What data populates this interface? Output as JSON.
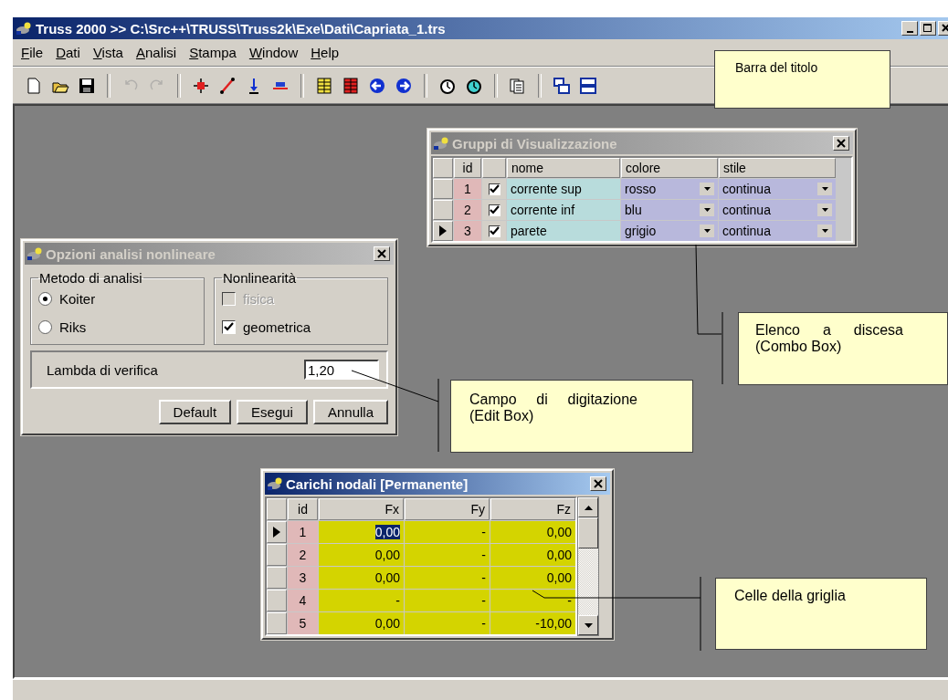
{
  "window": {
    "title": "Truss 2000 >> C:\\Src++\\TRUSS\\Truss2k\\Exe\\Dati\\Capriata_1.trs",
    "active": true
  },
  "menu": [
    {
      "label": "File"
    },
    {
      "label": "Dati"
    },
    {
      "label": "Vista"
    },
    {
      "label": "Analisi"
    },
    {
      "label": "Stampa"
    },
    {
      "label": "Window"
    },
    {
      "label": "Help"
    }
  ],
  "toolbar": [
    {
      "kind": "new",
      "disabled": false
    },
    {
      "kind": "open",
      "disabled": false
    },
    {
      "kind": "save",
      "disabled": false
    },
    {
      "kind": "sep"
    },
    {
      "kind": "undo",
      "disabled": true
    },
    {
      "kind": "redo",
      "disabled": true
    },
    {
      "kind": "sep"
    },
    {
      "kind": "node",
      "disabled": false
    },
    {
      "kind": "line",
      "disabled": false
    },
    {
      "kind": "load",
      "disabled": false
    },
    {
      "kind": "dload",
      "disabled": false
    },
    {
      "kind": "sep"
    },
    {
      "kind": "grid",
      "disabled": false
    },
    {
      "kind": "grid2",
      "disabled": false
    },
    {
      "kind": "back",
      "disabled": false
    },
    {
      "kind": "forward",
      "disabled": false
    },
    {
      "kind": "sep"
    },
    {
      "kind": "timer",
      "disabled": false
    },
    {
      "kind": "timer2",
      "disabled": false
    },
    {
      "kind": "sep"
    },
    {
      "kind": "pages",
      "disabled": false
    },
    {
      "kind": "sep"
    },
    {
      "kind": "cascade",
      "disabled": false
    },
    {
      "kind": "tile",
      "disabled": false
    }
  ],
  "groups_window": {
    "title": "Gruppi di Visualizzazione",
    "active": false,
    "id_column": "id",
    "columns": [
      "nome",
      "colore",
      "stile"
    ],
    "rows": [
      {
        "id": "1",
        "checked": true,
        "nome": "corrente sup",
        "colore": "rosso",
        "stile": "continua",
        "selected": false
      },
      {
        "id": "2",
        "checked": true,
        "nome": "corrente inf",
        "colore": "blu",
        "stile": "continua",
        "selected": false
      },
      {
        "id": "3",
        "checked": true,
        "nome": "parete",
        "colore": "grigio",
        "stile": "continua",
        "selected": true
      }
    ]
  },
  "options_dialog": {
    "title": "Opzioni analisi nonlineare",
    "active": false,
    "method_group": {
      "label": "Metodo di analisi",
      "options": [
        {
          "label": "Koiter",
          "selected": true
        },
        {
          "label": "Riks",
          "selected": false
        }
      ]
    },
    "nonlinearity_group": {
      "label": "Nonlinearità",
      "options": [
        {
          "label": "fisica",
          "checked": false,
          "disabled": true
        },
        {
          "label": "geometrica",
          "checked": true,
          "disabled": false
        }
      ]
    },
    "lambda": {
      "label": "Lambda di verifica",
      "value": "1,20"
    },
    "buttons": [
      "Default",
      "Esegui",
      "Annulla"
    ]
  },
  "loads_window": {
    "title": "Carichi nodali [Permanente]",
    "active": true,
    "id_column": "id",
    "columns": [
      "Fx",
      "Fy",
      "Fz"
    ],
    "rows": [
      {
        "id": "1",
        "selected": true,
        "cells": [
          {
            "text": "0,00",
            "selected": true
          },
          {
            "text": "-",
            "selected": false
          },
          {
            "text": "0,00",
            "selected": false
          }
        ]
      },
      {
        "id": "2",
        "selected": false,
        "cells": [
          {
            "text": "0,00",
            "selected": false
          },
          {
            "text": "-",
            "selected": false
          },
          {
            "text": "0,00",
            "selected": false
          }
        ]
      },
      {
        "id": "3",
        "selected": false,
        "cells": [
          {
            "text": "0,00",
            "selected": false
          },
          {
            "text": "-",
            "selected": false
          },
          {
            "text": "0,00",
            "selected": false
          }
        ]
      },
      {
        "id": "4",
        "selected": false,
        "cells": [
          {
            "text": "-",
            "selected": false
          },
          {
            "text": "-",
            "selected": false
          },
          {
            "text": "-",
            "selected": false
          }
        ]
      },
      {
        "id": "5",
        "selected": false,
        "cells": [
          {
            "text": "0,00",
            "selected": false
          },
          {
            "text": "-",
            "selected": false
          },
          {
            "text": "-10,00",
            "selected": false
          }
        ]
      }
    ]
  },
  "callouts": [
    {
      "kind": "title",
      "text": "Barra del titolo"
    },
    {
      "kind": "combo",
      "text": "Elenco a discesa (Combo Box)"
    },
    {
      "kind": "edit",
      "text": "Campo di digitazione (Edit Box)"
    },
    {
      "kind": "grid",
      "text": "Celle della griglia"
    }
  ]
}
